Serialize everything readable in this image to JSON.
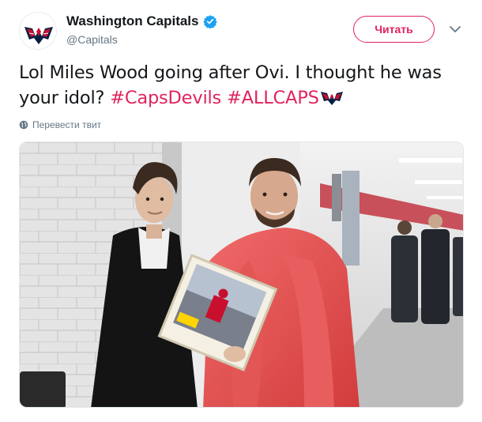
{
  "author": {
    "display_name": "Washington Capitals",
    "handle": "@Capitals",
    "verified": true,
    "avatar_icon": "capitals-eagle-logo",
    "verified_icon": "verified-badge-icon"
  },
  "actions": {
    "follow_label": "Читать",
    "menu_icon": "chevron-down-icon"
  },
  "tweet": {
    "text_plain": "Lol Miles Wood going after Ovi. I thought he was your idol?",
    "hashtags": [
      "#CapsDevils",
      "#ALLCAPS"
    ],
    "hashflag_icon": "capitals-eagle-hashflag-icon"
  },
  "translate": {
    "label": "Перевести твит",
    "icon": "globe-icon"
  },
  "media": {
    "type": "photo",
    "subject": "two hockey players posing in arena hallway with a framed photo"
  },
  "colors": {
    "accent": "#e0245e",
    "text": "#14171a",
    "muted": "#657786",
    "verified": "#1da1f2"
  }
}
